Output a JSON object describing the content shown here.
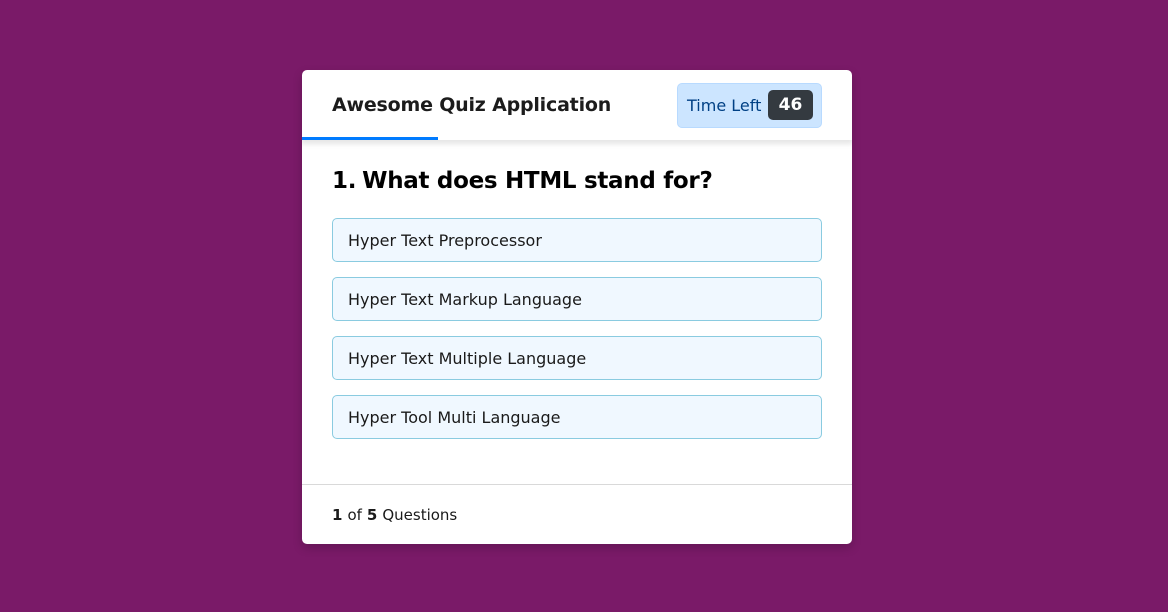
{
  "header": {
    "title": "Awesome Quiz Application",
    "timer_label": "Time Left",
    "timer_seconds": "46"
  },
  "question": {
    "number": "1.",
    "text": "What does HTML stand for?",
    "options": [
      "Hyper Text Preprocessor",
      "Hyper Text Markup Language",
      "Hyper Text Multiple Language",
      "Hyper Tool Multi Language"
    ]
  },
  "footer": {
    "current": "1",
    "of_label": "of",
    "total": "5",
    "questions_label": "Questions"
  },
  "colors": {
    "background": "#7a1a68",
    "accent": "#007bff",
    "timer_bg": "#cce5ff",
    "option_bg": "#f0f8ff"
  }
}
